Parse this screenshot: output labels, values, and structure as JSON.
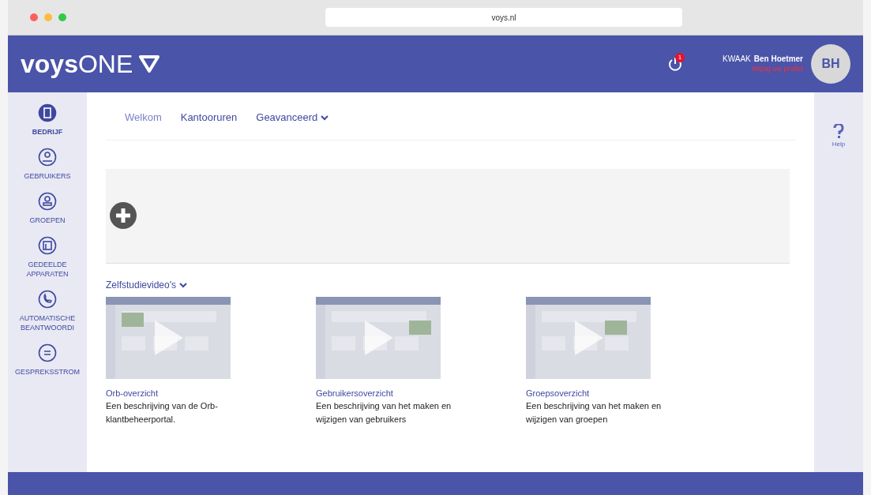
{
  "browser": {
    "url": "voys.nl"
  },
  "header": {
    "logo_bold": "voys",
    "logo_light": "ONE",
    "notification_badge": "1",
    "company": "KWAAK",
    "user": "Ben Hoetmer",
    "profile_link": "Wijzig uw profiel",
    "avatar": "BH"
  },
  "sidebar": {
    "items": [
      {
        "label": "BEDRIJF",
        "selected": true,
        "kind": "building"
      },
      {
        "label": "GEBRUIKERS",
        "selected": false,
        "kind": "user"
      },
      {
        "label": "GROEPEN",
        "selected": false,
        "kind": "group"
      },
      {
        "label": "GEDEELDE APPARATEN",
        "selected": false,
        "kind": "device"
      },
      {
        "label": "AUTOMATISCHE BEANTWOORDI",
        "selected": false,
        "kind": "phone"
      },
      {
        "label": "GESPREKSSTROM",
        "selected": false,
        "kind": "flow"
      }
    ]
  },
  "tabs": [
    {
      "label": "Welkom",
      "selected": true,
      "dropdown": false
    },
    {
      "label": "Kantooruren",
      "selected": false,
      "dropdown": false
    },
    {
      "label": "Geavanceerd",
      "selected": false,
      "dropdown": true
    }
  ],
  "videos": {
    "title": "Zelfstudievideo's",
    "items": [
      {
        "title": "Orb-overzicht",
        "description": "Een beschrijving van de Orb-klantbeheerportal."
      },
      {
        "title": "Gebruikersoverzicht",
        "description": "Een beschrijving van het maken en wijzigen van gebruikers"
      },
      {
        "title": "Groepsoverzicht",
        "description": "Een beschrijving van het maken en wijzigen van groepen"
      }
    ]
  },
  "help": {
    "label": "Help"
  }
}
